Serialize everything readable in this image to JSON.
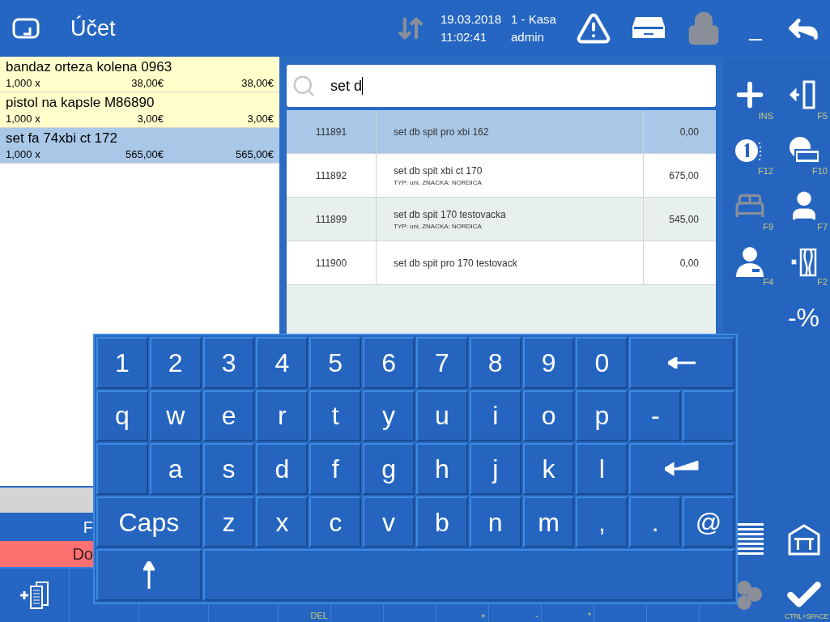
{
  "header": {
    "title": "Účet",
    "date": "19.03.2018",
    "time": "11:02:41",
    "register": "1 - Kasa",
    "user": "admin",
    "minimize": "_",
    "lock_disabled": true
  },
  "receipt": {
    "items": [
      {
        "name": "bandaz orteza kolena 0963",
        "qty": "1,000 x",
        "price": "38,00€",
        "total": "38,00€",
        "selected": false
      },
      {
        "name": "pistol na kapsle M86890",
        "qty": "1,000 x",
        "price": "3,00€",
        "total": "3,00€",
        "selected": false
      },
      {
        "name": "set fa 74xbi ct 172",
        "qty": "1,000 x",
        "price": "565,00€",
        "total": "565,00€",
        "selected": true
      }
    ],
    "total_bar": "F",
    "due_bar": "Do"
  },
  "search": {
    "value": "set d"
  },
  "results": [
    {
      "code": "111891",
      "name": "set db spit pro xbi 162",
      "price": "0,00",
      "selected": true
    },
    {
      "code": "111892",
      "name": "set db spit xbi ct 170",
      "detail": "TYP: uni, ZNACKA: NORDICA",
      "price": "675,00",
      "selected": false
    },
    {
      "code": "111899",
      "name": "set db spit 170 testovacka",
      "detail": "TYP: uni, ZNACKA: NORDICA",
      "price": "545,00",
      "selected": false
    },
    {
      "code": "111900",
      "name": "set db spit pro 170 testovack",
      "price": "0,00",
      "selected": false
    }
  ],
  "actions": [
    {
      "kind": "add",
      "hotkey": "INS",
      "disabled": false
    },
    {
      "kind": "transfer",
      "hotkey": "F5",
      "disabled": false
    },
    {
      "kind": "coin",
      "hotkey": "F12",
      "disabled": false
    },
    {
      "kind": "card",
      "hotkey": "F10",
      "disabled": false
    },
    {
      "kind": "bed",
      "hotkey": "F9",
      "disabled": true
    },
    {
      "kind": "person",
      "hotkey": "F7",
      "disabled": false
    },
    {
      "kind": "staff",
      "hotkey": "F4",
      "disabled": false
    },
    {
      "kind": "cancel-document",
      "hotkey": "F2",
      "disabled": false
    },
    {
      "kind": "empty"
    },
    {
      "kind": "text",
      "label": "-%",
      "disabled": false
    },
    {
      "kind": "empty"
    },
    {
      "kind": "empty"
    },
    {
      "kind": "empty"
    },
    {
      "kind": "empty"
    },
    {
      "kind": "empty"
    },
    {
      "kind": "empty"
    },
    {
      "kind": "list",
      "disabled": false
    },
    {
      "kind": "table",
      "disabled": false
    },
    {
      "kind": "coins",
      "disabled": true
    },
    {
      "kind": "confirm",
      "hotkey": "CTRL+SPACE",
      "disabled": false
    }
  ],
  "toolbar": [
    {
      "kind": "new-copy"
    },
    {
      "kind": "blank"
    },
    {
      "kind": "blank"
    },
    {
      "kind": "blank"
    },
    {
      "kind": "blank",
      "hotkey": "DEL"
    },
    {
      "kind": "blank"
    },
    {
      "kind": "blank"
    },
    {
      "kind": "blank",
      "hotkey": "+"
    },
    {
      "kind": "blank",
      "hotkey": "-"
    },
    {
      "kind": "blank",
      "hotkey": "*"
    },
    {
      "kind": "blank"
    },
    {
      "kind": "blank"
    }
  ],
  "keyboard": [
    [
      {
        "kind": "char",
        "label": "1"
      },
      {
        "kind": "char",
        "label": "2"
      },
      {
        "kind": "char",
        "label": "3"
      },
      {
        "kind": "char",
        "label": "4"
      },
      {
        "kind": "char",
        "label": "5"
      },
      {
        "kind": "char",
        "label": "6"
      },
      {
        "kind": "char",
        "label": "7"
      },
      {
        "kind": "char",
        "label": "8"
      },
      {
        "kind": "char",
        "label": "9"
      },
      {
        "kind": "char",
        "label": "0"
      },
      {
        "kind": "backspace"
      }
    ],
    [
      {
        "kind": "char",
        "label": "q"
      },
      {
        "kind": "char",
        "label": "w"
      },
      {
        "kind": "char",
        "label": "e"
      },
      {
        "kind": "char",
        "label": "r"
      },
      {
        "kind": "char",
        "label": "t"
      },
      {
        "kind": "char",
        "label": "y"
      },
      {
        "kind": "char",
        "label": "u"
      },
      {
        "kind": "char",
        "label": "i"
      },
      {
        "kind": "char",
        "label": "o"
      },
      {
        "kind": "char",
        "label": "p"
      },
      {
        "kind": "char",
        "label": "-"
      },
      {
        "kind": "blank"
      }
    ],
    [
      {
        "kind": "blank"
      },
      {
        "kind": "char",
        "label": "a"
      },
      {
        "kind": "char",
        "label": "s"
      },
      {
        "kind": "char",
        "label": "d"
      },
      {
        "kind": "char",
        "label": "f"
      },
      {
        "kind": "char",
        "label": "g"
      },
      {
        "kind": "char",
        "label": "h"
      },
      {
        "kind": "char",
        "label": "j"
      },
      {
        "kind": "char",
        "label": "k"
      },
      {
        "kind": "char",
        "label": "l"
      },
      {
        "kind": "enter"
      }
    ],
    [
      {
        "kind": "wide",
        "label": "Caps"
      },
      {
        "kind": "char",
        "label": "z"
      },
      {
        "kind": "char",
        "label": "x"
      },
      {
        "kind": "char",
        "label": "c"
      },
      {
        "kind": "char",
        "label": "v"
      },
      {
        "kind": "char",
        "label": "b"
      },
      {
        "kind": "char",
        "label": "n"
      },
      {
        "kind": "char",
        "label": "m"
      },
      {
        "kind": "char",
        "label": ","
      },
      {
        "kind": "char",
        "label": "."
      },
      {
        "kind": "char",
        "label": "@"
      }
    ],
    [
      {
        "kind": "shift"
      },
      {
        "kind": "space"
      }
    ]
  ]
}
